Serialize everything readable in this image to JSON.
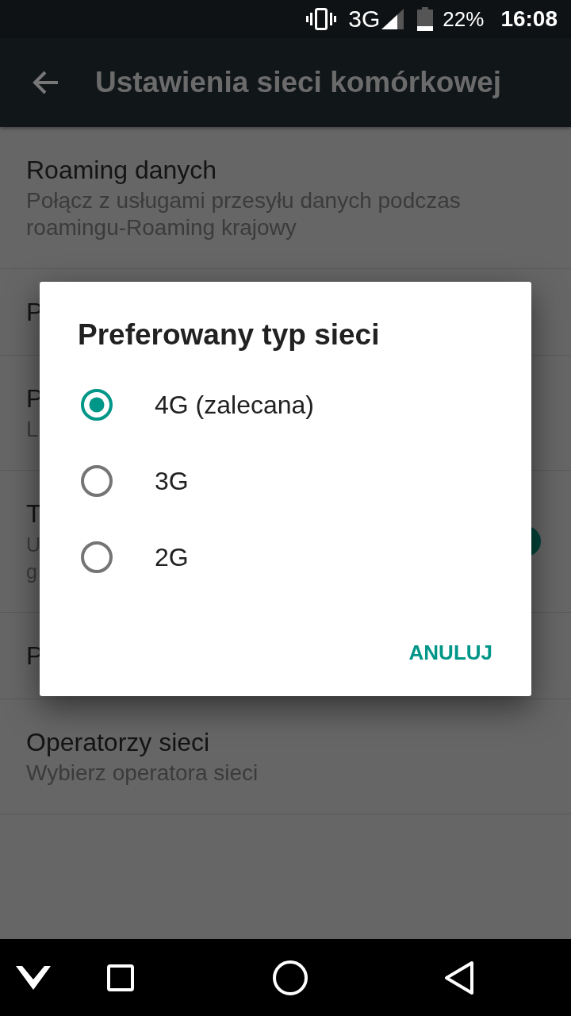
{
  "status_bar": {
    "network": "3G",
    "battery": "22%",
    "time": "16:08"
  },
  "app_bar": {
    "title": "Ustawienia sieci komórkowej"
  },
  "settings": [
    {
      "title": "Roaming danych",
      "summary": "Połącz z usługami przesyłu danych podczas roamingu-Roaming krajowy"
    },
    {
      "title": "P"
    },
    {
      "title": "P",
      "summary": "L"
    },
    {
      "title": "T",
      "summary_lines": [
        "U",
        "g"
      ],
      "switch": {
        "on": true
      }
    },
    {
      "title": "P"
    },
    {
      "title": "Operatorzy sieci",
      "summary": "Wybierz operatora sieci"
    }
  ],
  "dialog": {
    "title": "Preferowany typ sieci",
    "options": [
      {
        "label": "4G (zalecana)",
        "selected": true
      },
      {
        "label": "3G",
        "selected": false
      },
      {
        "label": "2G",
        "selected": false
      }
    ],
    "buttons": [
      "ANULUJ"
    ]
  }
}
